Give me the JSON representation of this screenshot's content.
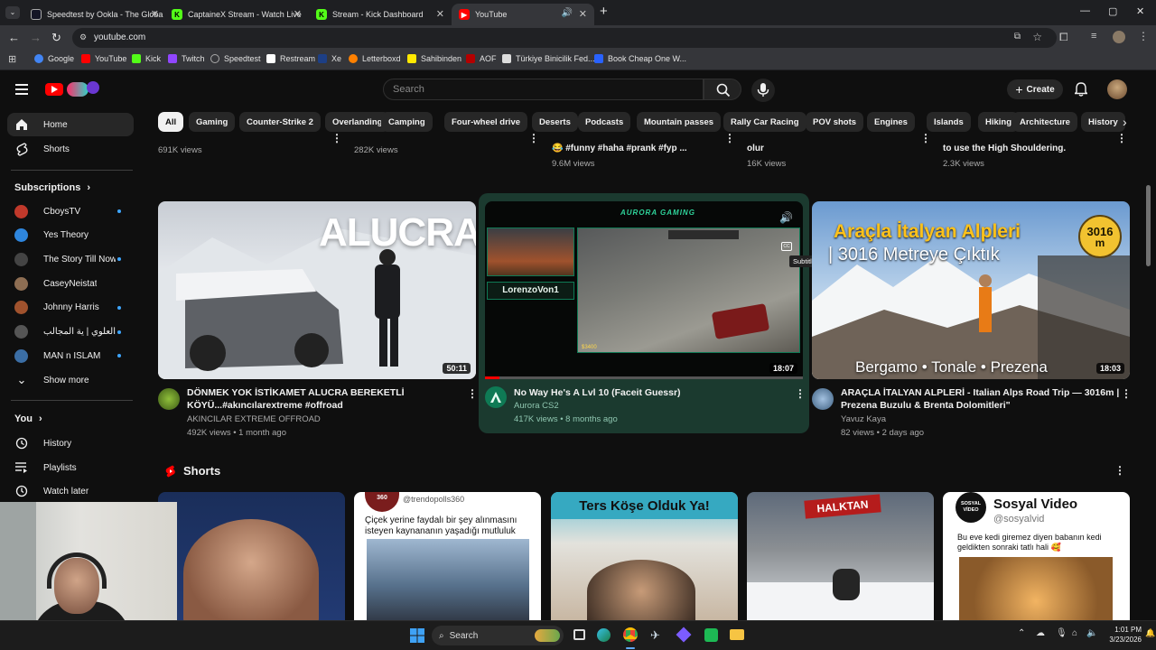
{
  "browser": {
    "tabs": [
      {
        "title": "Speedtest by Ookla - The Globa",
        "color": "#141526",
        "icon": "speedtest-icon"
      },
      {
        "title": "CaptaineX Stream - Watch Live",
        "color": "#53fc18",
        "icon": "kick-icon"
      },
      {
        "title": "Stream - Kick Dashboard",
        "color": "#53fc18",
        "icon": "kick-icon"
      },
      {
        "title": "YouTube",
        "color": "#ff0000",
        "icon": "youtube-icon"
      }
    ],
    "url": "youtube.com",
    "bookmarks": [
      {
        "label": "Google",
        "color": "#4285f4"
      },
      {
        "label": "YouTube",
        "color": "#ff0000"
      },
      {
        "label": "Kick",
        "color": "#53fc18"
      },
      {
        "label": "Twitch",
        "color": "#9146ff"
      },
      {
        "label": "Speedtest",
        "color": "#aaaaaa"
      },
      {
        "label": "Restream",
        "color": "#ffffff"
      },
      {
        "label": "Xe",
        "color": "#1d3f85"
      },
      {
        "label": "Letterboxd",
        "color": "#ff8000"
      },
      {
        "label": "Sahibinden",
        "color": "#ffe800"
      },
      {
        "label": "AOF",
        "color": "#b40000"
      },
      {
        "label": "Türkiye Binicilik Fed...",
        "color": "#dddddd"
      },
      {
        "label": "Book Cheap One W...",
        "color": "#2962ff"
      }
    ]
  },
  "header": {
    "search_placeholder": "Search",
    "create_label": "Create"
  },
  "chips": [
    "All",
    "Gaming",
    "Counter-Strike 2",
    "Overlanding",
    "Camping",
    "Four-wheel drive",
    "Deserts",
    "Podcasts",
    "Mountain passes",
    "Rally Car Racing",
    "POV shots",
    "Engines",
    "Islands",
    "Hiking",
    "Architecture",
    "History"
  ],
  "sidebar": {
    "home": "Home",
    "shorts": "Shorts",
    "subscriptions_title": "Subscriptions",
    "subscriptions": [
      {
        "name": "CboysTV",
        "color": "#c0392b",
        "dot": true
      },
      {
        "name": "Yes Theory",
        "color": "#2e86de",
        "dot": false
      },
      {
        "name": "The Story Till Now",
        "color": "#444444",
        "dot": true
      },
      {
        "name": "CaseyNeistat",
        "color": "#8e6e53",
        "dot": false
      },
      {
        "name": "Johnny Harris",
        "color": "#a0522d",
        "dot": true
      },
      {
        "name": "بدر العلوي | ية المجالب",
        "color": "#555555",
        "dot": true
      },
      {
        "name": "MAN n ISLAM",
        "color": "#3b6ea5",
        "dot": true
      }
    ],
    "show_more": "Show more",
    "you_title": "You",
    "you_items": [
      "History",
      "Playlists",
      "Watch later"
    ]
  },
  "top_row": [
    {
      "line1": "",
      "line2": "691K views"
    },
    {
      "line1": "",
      "line2": "282K views"
    },
    {
      "line1": "😂 #funny #haha #prank #fyp ...",
      "line2": "9.6M views"
    },
    {
      "line1": "olur",
      "line2": "16K views"
    },
    {
      "line1": "to use the High Shouldering.",
      "line2": "2.3K views"
    }
  ],
  "videos": [
    {
      "thumb_text": "ALUCRA",
      "duration": "50:11",
      "title_line1": "DÖNMEK YOK İSTİKAMET ALUCRA BEREKETLİ",
      "title_line2": "KÖYÜ...#akıncılarextreme #offroad",
      "channel": "AKINCILAR EXTREME OFFROAD",
      "meta": "492K views • 1 month ago"
    },
    {
      "logo_text": "AURORA GAMING",
      "name_tag": "LorenzoVon1",
      "duration": "18:07",
      "title_line1": "No Way He's A Lvl 10 (Faceit Guessr)",
      "channel": "Aurora CS2",
      "meta": "417K views • 8 months ago",
      "tooltip": "Subtitles/CC turned off",
      "hud_money": "$3400"
    },
    {
      "thumb_title1": "Araçla İtalyan Alpleri",
      "thumb_title2": "| 3016 Metreye Çıktık",
      "badge_top": "3016",
      "badge_bottom": "m",
      "thumb_caption": "Bergamo • Tonale • Prezena",
      "duration": "18:03",
      "title_line1": "ARAÇLA İTALYAN ALPLERİ  -  Italian Alps Road Trip — 3016m |",
      "title_line2": "Prezena Buzulu & Brenta Dolomitleri\"",
      "channel": "Yavuz Kaya",
      "meta": "82 views • 2 days ago"
    }
  ],
  "shorts": {
    "title": "Shorts",
    "cards": [
      {
        "text1": "",
        "text2": ""
      },
      {
        "text1": "@trendopolls360",
        "text2": "Çiçek yerine faydalı bir şey alınmasını isteyen kaynananın yaşadığı mutluluk",
        "badge": "360"
      },
      {
        "text1": "Ters Köşe Olduk Ya!",
        "text2": ""
      },
      {
        "text1": "HALKTAN",
        "text2": ""
      },
      {
        "text1": "Sosyal Video",
        "text2": "@sosyalvid",
        "text3": "Bu eve kedi giremez diyen babanın kedi geldikten sonraki tatlı hali 🥰",
        "badge": "SOSYAL VİDEO"
      }
    ]
  },
  "taskbar": {
    "search": "Search",
    "time": "1:01 PM",
    "date": "3/23/2026"
  },
  "colors": {
    "accent_blue": "#3ea6ff",
    "yt_red": "#ff0000",
    "aurora_green": "#0f7a55"
  }
}
